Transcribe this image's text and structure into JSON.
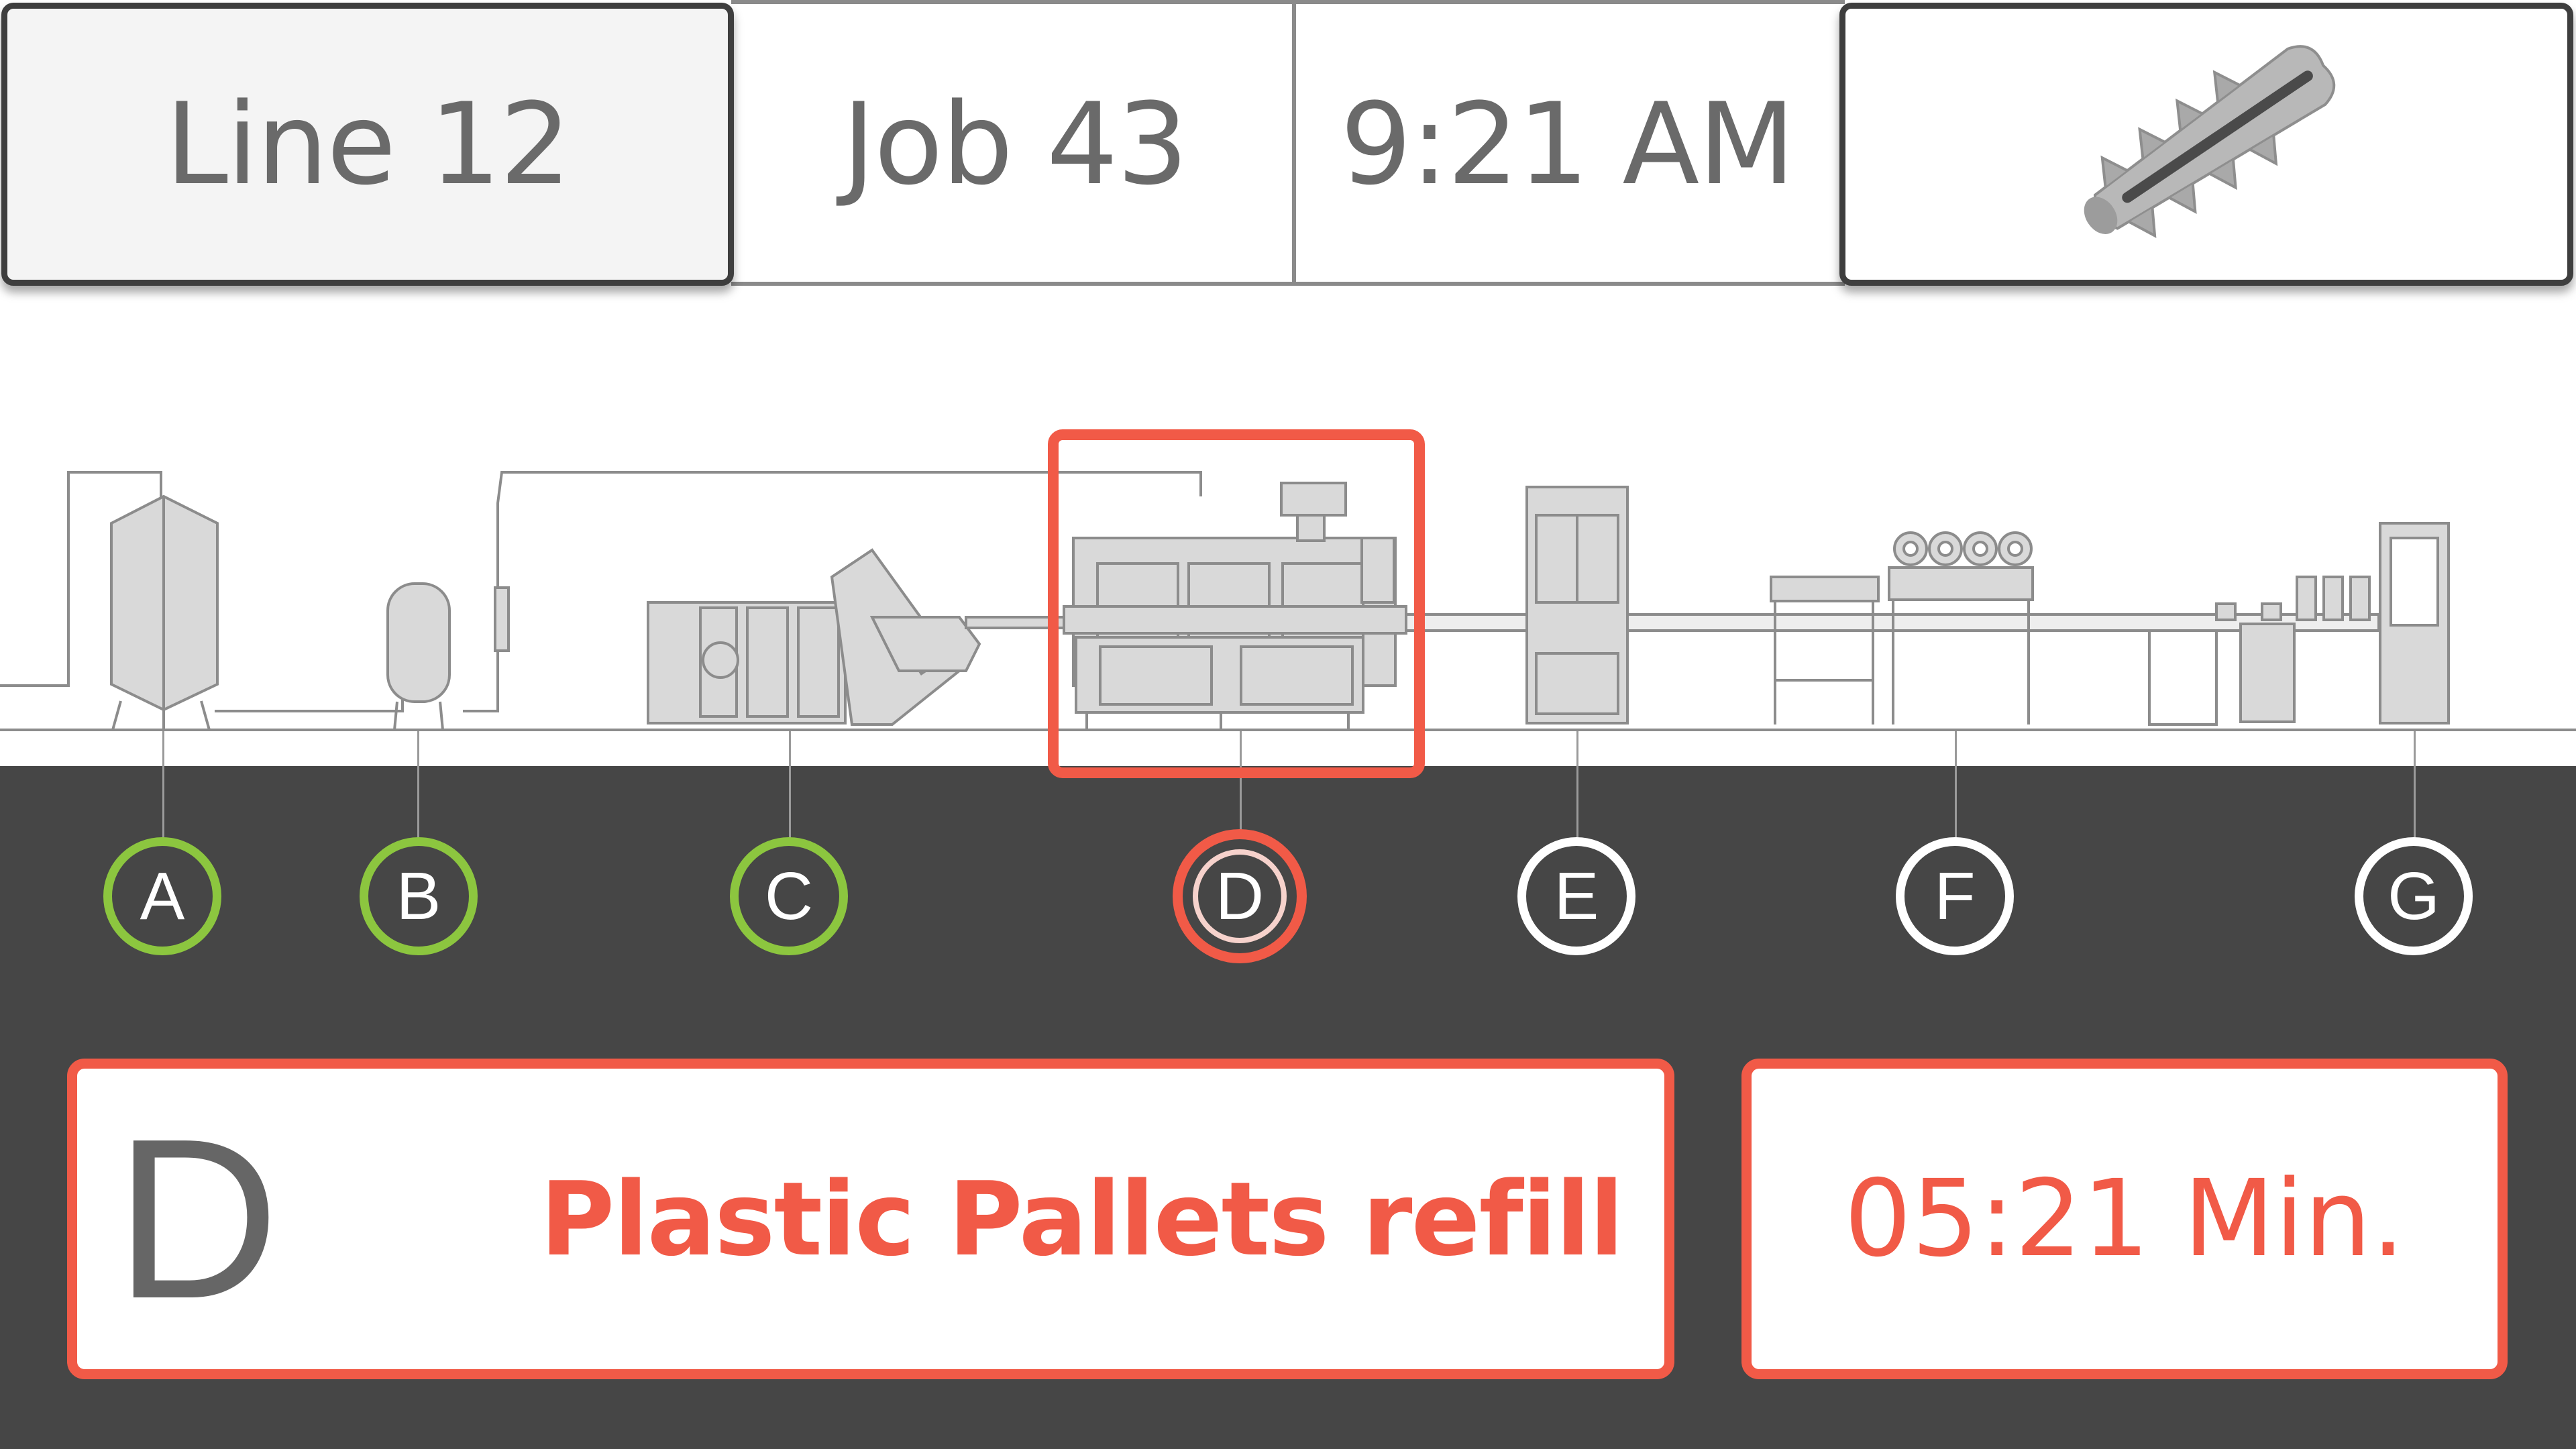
{
  "header": {
    "line_label": "Line 12",
    "job_label": "Job 43",
    "time": "9:21 AM",
    "product_icon": "wall-plug-anchor-icon"
  },
  "stations": [
    {
      "label": "A",
      "state": "ok"
    },
    {
      "label": "B",
      "state": "ok"
    },
    {
      "label": "C",
      "state": "ok"
    },
    {
      "label": "D",
      "state": "alert"
    },
    {
      "label": "E",
      "state": "idle"
    },
    {
      "label": "F",
      "state": "idle"
    },
    {
      "label": "G",
      "state": "idle"
    }
  ],
  "status": {
    "station": "D",
    "message": "Plastic Pallets refill",
    "duration": "05:21 Min."
  },
  "colors": {
    "ok": "#8cc63f",
    "alert": "#f15a47",
    "panel": "#464646",
    "machine": "#d9d9d9"
  }
}
